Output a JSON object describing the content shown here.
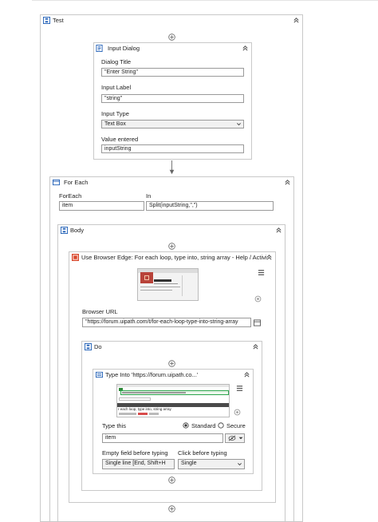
{
  "sequence": {
    "title": "Test"
  },
  "input_dialog": {
    "title": "Input Dialog",
    "dialog_title_label": "Dialog Title",
    "dialog_title_value": "\"Enter String\"",
    "input_label_label": "Input Label",
    "input_label_value": "\"string\"",
    "input_type_label": "Input Type",
    "input_type_value": "Text Box",
    "value_entered_label": "Value entered",
    "value_entered_value": "inputString"
  },
  "for_each": {
    "title": "For Each",
    "foreach_label": "ForEach",
    "foreach_value": "item",
    "in_label": "In",
    "in_value": "Split(inputString,\",\")"
  },
  "body": {
    "title": "Body"
  },
  "browser": {
    "title": "Use Browser Edge: For each loop, type into, string array - Help / Activiti",
    "url_label": "Browser URL",
    "url_value": "\"https://forum.uipath.com/t/for-each-loop-type-into-string-array"
  },
  "do": {
    "title": "Do"
  },
  "type_into": {
    "title": "Type Into 'https://forum.uipath.co...'",
    "thumb_caption": "r each loop, type into, string array",
    "type_this_label": "Type this",
    "type_this_value": "item",
    "radio_standard": "Standard",
    "radio_secure": "Secure",
    "empty_field_label": "Empty field before typing",
    "empty_field_value": "Single line [End, Shift+H",
    "click_before_label": "Click before typing",
    "click_before_value": "Single"
  },
  "colors": {
    "accent": "#1e5eb6",
    "border": "#c9c9c9",
    "browser_icon": "#d9472b"
  }
}
